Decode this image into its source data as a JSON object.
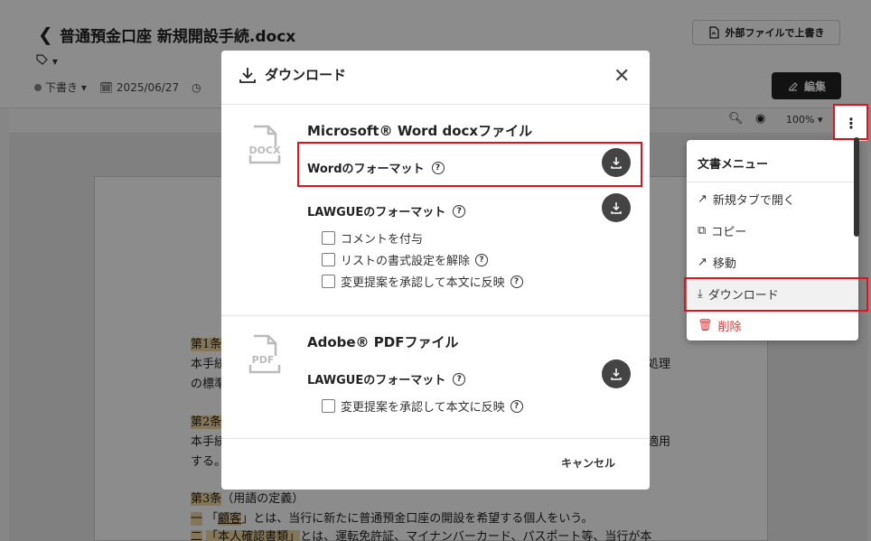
{
  "header": {
    "back_icon": "chevron-left-icon",
    "title": "普通預金口座 新規開設手続.docx",
    "overwrite_label": "外部ファイルで上書き",
    "tag_icon": "tag-icon",
    "status": "下書き",
    "date": "2025/06/27",
    "edit_label": "編集"
  },
  "toolbar": {
    "zoom": "100%"
  },
  "document": {
    "art1_label": "第1条",
    "art1_line1_prefix": "本手続",
    "art1_line1_suffix": "処理",
    "art1_line2": "の標準",
    "art2_label": "第2条",
    "art2_line1_prefix": "本手続",
    "art2_line1_suffix": "適用",
    "art2_line2": "する。",
    "art3_label": "第3条",
    "art3_title": "（用語の定義）",
    "item1_num": "一",
    "item1_open": "「",
    "item1_term": "顧客",
    "item1_rest": "」とは、当行に新たに普通預金口座の開設を希望する個人をいう。",
    "item2_num": "二",
    "item2_term": "「本人確認書類」",
    "item2_rest": "とは、運転免許証、マイナンバーカード、パスポート等、当行が本"
  },
  "modal": {
    "title": "ダウンロード",
    "word_section": {
      "icon_label": "DOCX",
      "title": "Microsoft® Word docxファイル",
      "word_format": "Wordのフォーマット",
      "lawgue_format": "LAWGUEのフォーマット",
      "options": [
        "コメントを付与",
        "リストの書式設定を解除",
        "変更提案を承認して本文に反映"
      ]
    },
    "pdf_section": {
      "icon_label": "PDF",
      "title": "Adobe® PDFファイル",
      "lawgue_format": "LAWGUEのフォーマット",
      "options": [
        "変更提案を承認して本文に反映"
      ]
    },
    "cancel_label": "キャンセル"
  },
  "menu": {
    "title": "文書メニュー",
    "items": [
      {
        "label": "新規タブで開く",
        "icon": "external-link-icon"
      },
      {
        "label": "コピー",
        "icon": "copy-icon"
      },
      {
        "label": "移動",
        "icon": "arrow-up-right-icon"
      },
      {
        "label": "ダウンロード",
        "icon": "download-icon"
      },
      {
        "label": "削除",
        "icon": "trash-icon"
      }
    ]
  },
  "colors": {
    "highlight_red": "#e0141e",
    "danger": "#dd3333",
    "dark_button": "#222222"
  }
}
